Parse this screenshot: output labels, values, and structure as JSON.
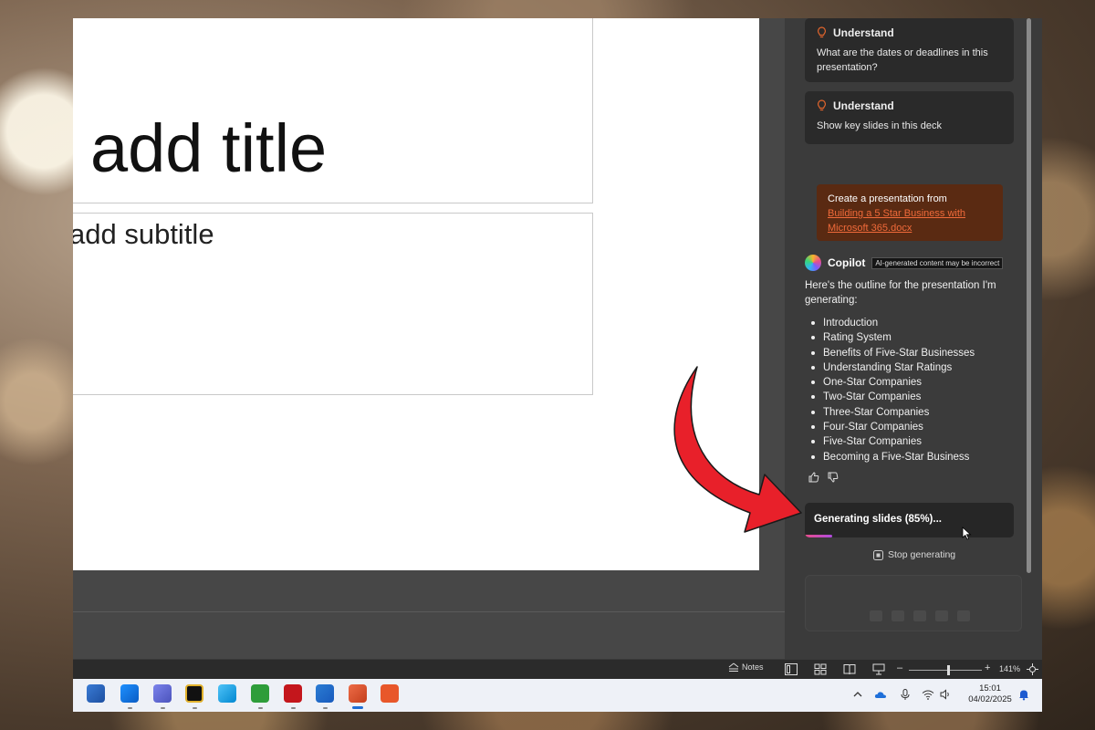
{
  "slide": {
    "title_placeholder": "add title",
    "subtitle_placeholder": "add subtitle"
  },
  "copilot": {
    "suggestions": [
      {
        "category": "Understand",
        "text": "What are the dates or deadlines in this presentation?"
      },
      {
        "category": "Understand",
        "text": "Show key slides in this deck"
      }
    ],
    "user_message": {
      "prefix": "Create a presentation from",
      "link": "Building a 5 Star Business with Microsoft 365.docx"
    },
    "assistant_name": "Copilot",
    "ai_badge": "AI-generated content may be incorrect",
    "response_intro": "Here's the outline for the presentation I'm generating:",
    "outline": [
      "Introduction",
      "Rating System",
      "Benefits of Five-Star Businesses",
      "Understanding Star Ratings",
      "One-Star Companies",
      "Two-Star Companies",
      "Three-Star Companies",
      "Four-Star Companies",
      "Five-Star Companies",
      "Becoming a Five-Star Business"
    ],
    "generating": {
      "label": "Generating slides (85%)...",
      "progress_percent": 85,
      "progress_fill_fraction": 0.13
    },
    "stop_label": "Stop generating"
  },
  "statusbar": {
    "notes_label": "Notes",
    "zoom_level": "141%",
    "zoom_minus": "–",
    "zoom_plus": "+"
  },
  "taskbar": {
    "apps": [
      "windows-store",
      "outlook",
      "teams",
      "app-gold",
      "files",
      "camtasia",
      "acrobat",
      "word",
      "powerpoint",
      "snagit"
    ],
    "time": "15:01",
    "date": "04/02/2025"
  },
  "colors": {
    "accent_link": "#f06a3a",
    "user_bubble": "#5a2a12",
    "arrow": "#e8202a",
    "progress": "#e94e8a"
  }
}
